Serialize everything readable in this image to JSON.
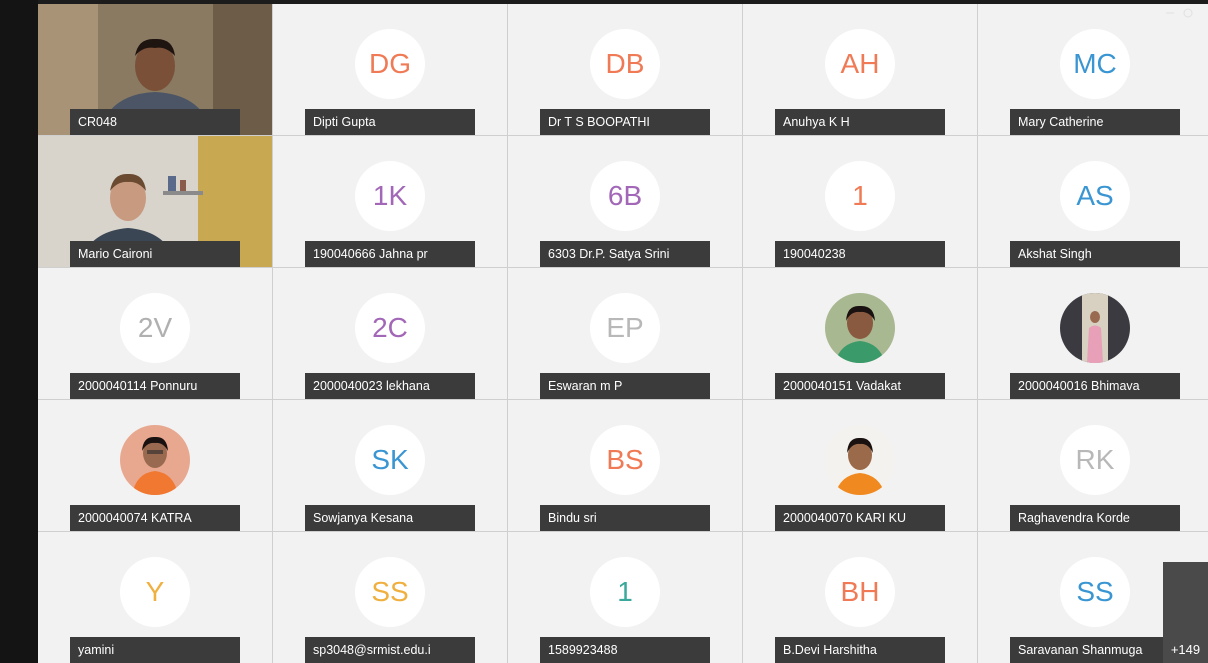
{
  "tiles": [
    {
      "name": "CR048",
      "type": "video"
    },
    {
      "name": "Dipti Gupta",
      "initials": "DG",
      "color": "#f07a55"
    },
    {
      "name": "Dr T S BOOPATHI",
      "initials": "DB",
      "color": "#f07a55"
    },
    {
      "name": "Anuhya K H",
      "initials": "AH",
      "color": "#f07a55"
    },
    {
      "name": "Mary Catherine",
      "initials": "MC",
      "color": "#3a96d2"
    },
    {
      "name": "Mario Caironi",
      "type": "video"
    },
    {
      "name": "190040666 Jahna pr",
      "initials": "1K",
      "color": "#a268b7"
    },
    {
      "name": "6303 Dr.P. Satya Srini",
      "initials": "6B",
      "color": "#a268b7"
    },
    {
      "name": "190040238",
      "initials": "1",
      "color": "#f07a55"
    },
    {
      "name": "Akshat Singh",
      "initials": "AS",
      "color": "#3a96d2"
    },
    {
      "name": "2000040114 Ponnuru",
      "initials": "2V",
      "color": "#b0b0b0"
    },
    {
      "name": "2000040023 lekhana",
      "initials": "2C",
      "color": "#a268b7"
    },
    {
      "name": "Eswaran m P",
      "initials": "EP",
      "color": "#b8b8b8"
    },
    {
      "name": "2000040151 Vadakat",
      "type": "photo"
    },
    {
      "name": "2000040016 Bhimava",
      "type": "photo"
    },
    {
      "name": "2000040074 KATRA",
      "type": "photo"
    },
    {
      "name": "Sowjanya Kesana",
      "initials": "SK",
      "color": "#3a96d2"
    },
    {
      "name": "Bindu sri",
      "initials": "BS",
      "color": "#f07a55"
    },
    {
      "name": "2000040070 KARI KU",
      "type": "photo"
    },
    {
      "name": "Raghavendra Korde",
      "initials": "RK",
      "color": "#b8b8b8"
    },
    {
      "name": "yamini",
      "initials": "Y",
      "color": "#f0b040"
    },
    {
      "name": "sp3048@srmist.edu.i",
      "initials": "SS",
      "color": "#f0b040"
    },
    {
      "name": "1589923488",
      "initials": "1",
      "color": "#3aa89a"
    },
    {
      "name": "B.Devi Harshitha",
      "initials": "BH",
      "color": "#f07a55"
    },
    {
      "name": "Saravanan Shanmuga",
      "initials": "SS",
      "color": "#3a96d2"
    }
  ],
  "more_participants": "+149"
}
